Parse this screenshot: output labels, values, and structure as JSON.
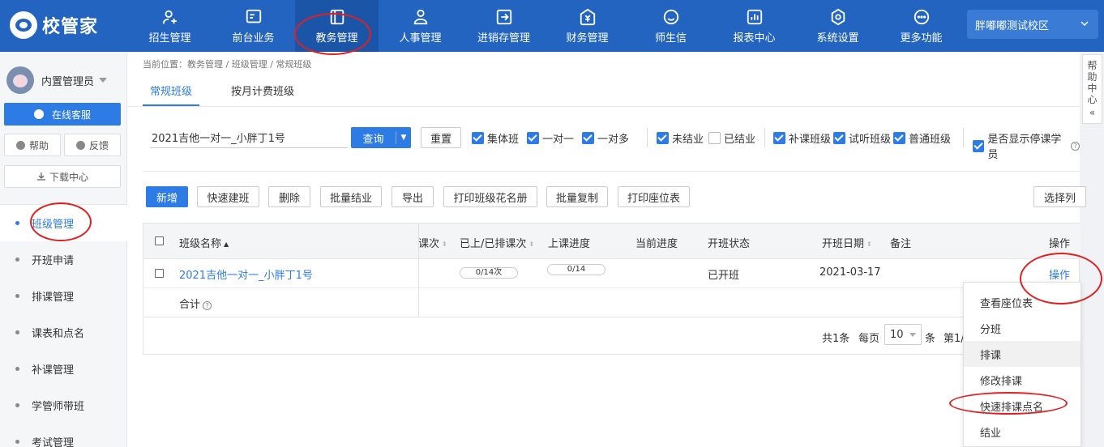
{
  "app": {
    "logo_text": "校管家",
    "campus": "胖嘟嘟测试校区"
  },
  "nav": [
    {
      "label": "招生管理",
      "icon": "user-add-icon"
    },
    {
      "label": "前台业务",
      "icon": "monitor-icon"
    },
    {
      "label": "教务管理",
      "icon": "book-icon"
    },
    {
      "label": "人事管理",
      "icon": "person-icon"
    },
    {
      "label": "进销存管理",
      "icon": "inventory-icon"
    },
    {
      "label": "财务管理",
      "icon": "money-icon"
    },
    {
      "label": "师生信",
      "icon": "chat-icon"
    },
    {
      "label": "报表中心",
      "icon": "report-icon"
    },
    {
      "label": "系统设置",
      "icon": "gear-icon"
    },
    {
      "label": "更多功能",
      "icon": "more-icon"
    }
  ],
  "sidebar": {
    "user_name": "内置管理员",
    "online_service": "在线客服",
    "help": "帮助",
    "feedback": "反馈",
    "download_center": "下载中心",
    "items": [
      "班级管理",
      "开班申请",
      "排课管理",
      "课表和点名",
      "补课管理",
      "学管师带班",
      "考试管理"
    ]
  },
  "breadcrumb": "当前位置：教务管理 / 班级管理 / 常规班级",
  "tabs": [
    "常规班级",
    "按月计费班级"
  ],
  "filters": {
    "search_value": "2021吉他一对一_小胖丁1号",
    "query": "查询",
    "reset": "重置",
    "checks": [
      {
        "label": "集体班",
        "checked": true
      },
      {
        "label": "一对一",
        "checked": true
      },
      {
        "label": "一对多",
        "checked": true
      },
      {
        "label": "未结业",
        "checked": true
      },
      {
        "label": "已结业",
        "checked": false
      },
      {
        "label": "补课班级",
        "checked": true
      },
      {
        "label": "试听班级",
        "checked": true
      },
      {
        "label": "普通班级",
        "checked": true
      },
      {
        "label": "是否显示停课学员",
        "checked": true
      }
    ]
  },
  "toolbar": {
    "new": "新增",
    "quick_create": "快速建班",
    "delete": "删除",
    "batch_graduate": "批量结业",
    "export": "导出",
    "print_roster": "打印班级花名册",
    "batch_copy": "批量复制",
    "print_seats": "打印座位表",
    "select_columns": "选择列"
  },
  "table": {
    "headers": {
      "name": "班级名称",
      "lessons": "课次",
      "done_scheduled": "已上/已排课次",
      "progress": "上课进度",
      "current_progress": "当前进度",
      "status": "开班状态",
      "start_date": "开班日期",
      "note": "备注",
      "action": "操作"
    },
    "row": {
      "name": "2021吉他一对一_小胖丁1号",
      "done_scheduled": "0/14次",
      "progress": "0/14",
      "status": "已开班",
      "start_date": "2021-03-17",
      "action": "操作"
    },
    "total_label": "合计"
  },
  "pager": {
    "total": "共1条",
    "per_page": "每页",
    "size": "10",
    "unit": "条",
    "page": "第1/"
  },
  "menu": [
    "查看座位表",
    "分班",
    "排课",
    "修改排课",
    "快速排课点名",
    "结业"
  ],
  "help_center": "帮助中心"
}
